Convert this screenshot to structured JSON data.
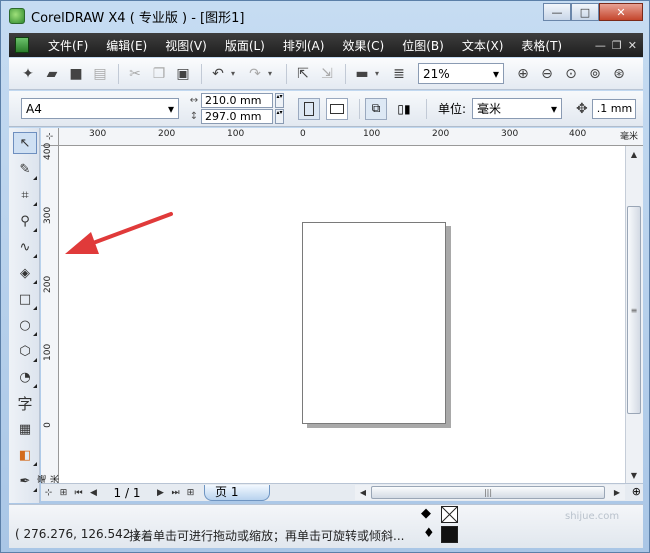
{
  "title": "CorelDRAW X4 ( 专业版 ) - [图形1]",
  "window_controls": {
    "minimize": "—",
    "maximize": "□",
    "close": "✕"
  },
  "menu": [
    "文件(F)",
    "编辑(E)",
    "视图(V)",
    "版面(L)",
    "排列(A)",
    "效果(C)",
    "位图(B)",
    "文本(X)",
    "表格(T)"
  ],
  "mdi_controls": [
    "—",
    "❐",
    "✕"
  ],
  "toolbar": {
    "zoom_value": "21%"
  },
  "property_bar": {
    "paper_size": "A4",
    "width": "210.0 mm",
    "height": "297.0 mm",
    "unit_label": "单位:",
    "unit_value": "毫米",
    "nudge_value": ".1 mm"
  },
  "rulers": {
    "corner_label": "毫米",
    "horizontal_labels": [
      "300",
      "200",
      "100",
      "0",
      "100",
      "200",
      "300",
      "400"
    ],
    "horizontal_unit": "毫米",
    "vertical_labels": [
      "400",
      "300",
      "200",
      "100",
      "0"
    ],
    "vertical_unit": "毫米"
  },
  "navigator": {
    "page_count": "1 / 1",
    "page_tab": "页 1"
  },
  "statusbar": {
    "coordinates": "( 276.276, 126.542 )",
    "hint": "接着单击可进行拖动或缩放；再单击可旋转或倾斜...",
    "watermark": "shijue.com"
  },
  "colors": {
    "menubar": "#2a2a2a",
    "annotation_arrow": "#e03a3a",
    "active_tab": "#b8d2ee"
  }
}
